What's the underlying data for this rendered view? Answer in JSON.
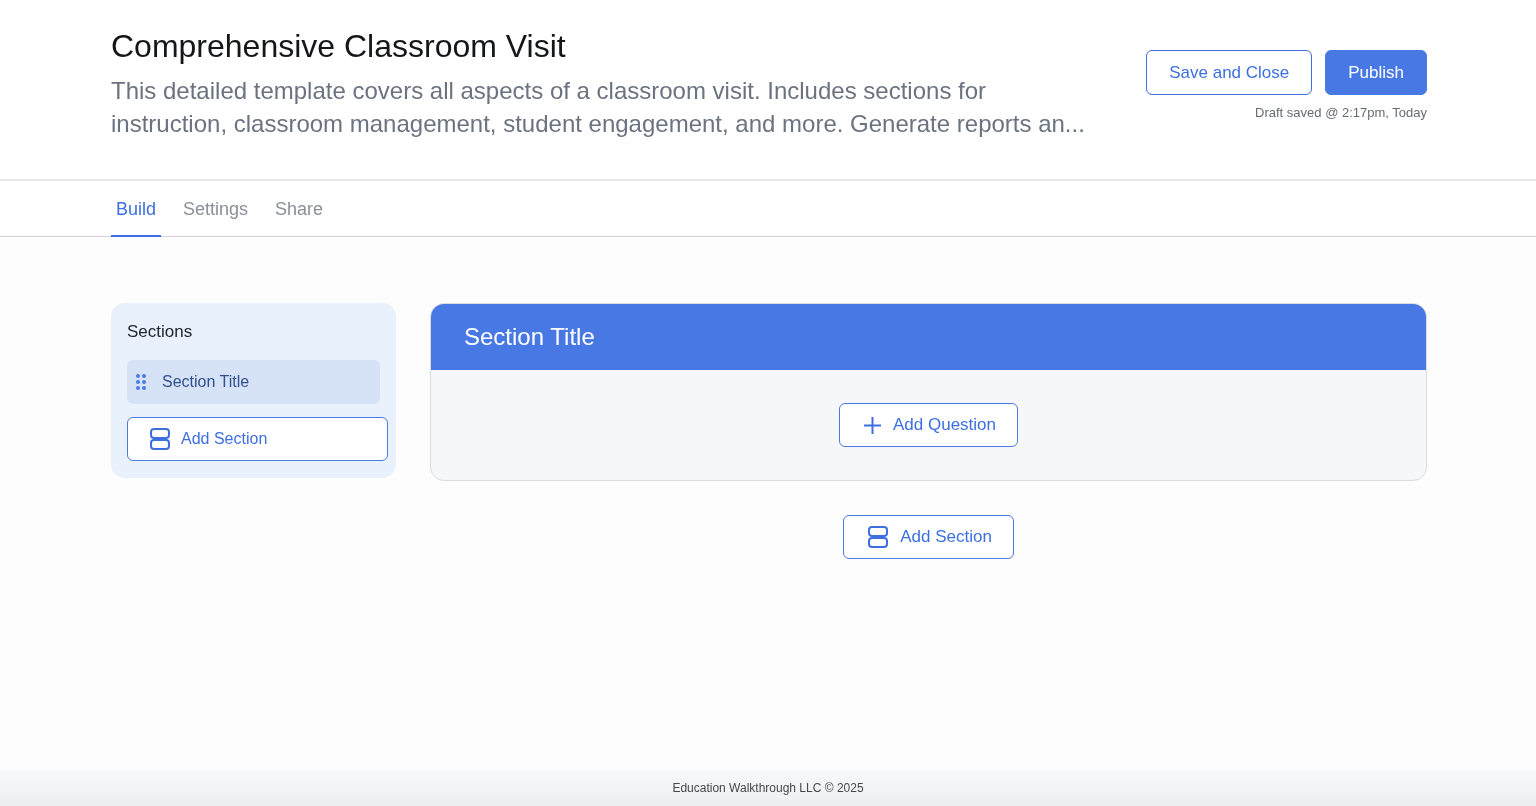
{
  "header": {
    "title": "Comprehensive Classroom Visit",
    "description": "This detailed template covers all aspects of a classroom visit. Includes sections for instruction, classroom management, student engagement, and more. Generate reports an...",
    "actions": [
      {
        "label": "Save and Close",
        "kind": "secondary"
      },
      {
        "label": "Publish",
        "kind": "primary"
      }
    ],
    "save_status": "Draft saved @ 2:17pm, Today"
  },
  "tabs": [
    {
      "label": "Build",
      "selected": true
    },
    {
      "label": "Settings",
      "selected": false
    },
    {
      "label": "Share",
      "selected": false
    }
  ],
  "sidebar": {
    "title": "Sections",
    "items": [
      {
        "label": "Section Title",
        "selected": true
      }
    ],
    "add_button": "Add Section"
  },
  "sections": [
    {
      "title": "Section Title",
      "add_question_button": "Add Question"
    }
  ],
  "add_section_button": "Add Section",
  "footer": {
    "text": "Education Walkthrough LLC © 2025"
  }
}
